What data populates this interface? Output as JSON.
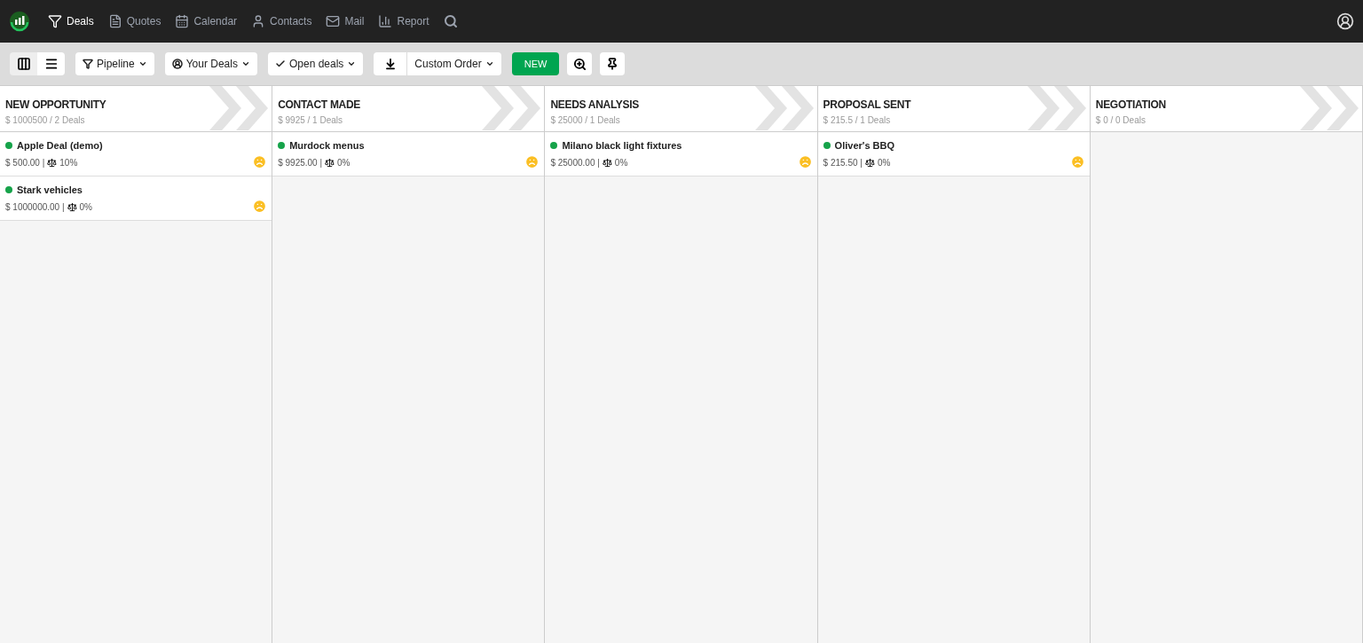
{
  "nav": {
    "items": [
      {
        "kind": "deals",
        "label": "Deals",
        "selected": true
      },
      {
        "kind": "quotes",
        "label": "Quotes",
        "selected": false
      },
      {
        "kind": "calendar",
        "label": "Calendar",
        "selected": false
      },
      {
        "kind": "contacts",
        "label": "Contacts",
        "selected": false
      },
      {
        "kind": "mail",
        "label": "Mail",
        "selected": false
      },
      {
        "kind": "report",
        "label": "Report",
        "selected": false
      }
    ]
  },
  "toolbar": {
    "views": [
      {
        "kind": "kanban",
        "selected": true
      },
      {
        "kind": "list",
        "selected": false
      }
    ],
    "filters": [
      {
        "kind": "pipeline",
        "label": "Pipeline"
      },
      {
        "kind": "owner",
        "label": "Your Deals"
      },
      {
        "kind": "status",
        "label": "Open deals"
      }
    ],
    "sort": {
      "label": "Custom Order"
    },
    "new_button": "NEW"
  },
  "stages": [
    {
      "title": "NEW OPPORTUNITY",
      "summary": "$ 1000500 / 2 Deals",
      "deals": [
        {
          "name": "Apple Deal (demo)",
          "amount": "$ 500.00 |",
          "probability": "10%",
          "color": "#16a34a"
        },
        {
          "name": "Stark vehicles",
          "amount": "$ 1000000.00 |",
          "probability": "0%",
          "color": "#16a34a"
        }
      ]
    },
    {
      "title": "CONTACT MADE",
      "summary": "$ 9925 / 1 Deals",
      "deals": [
        {
          "name": "Murdock menus",
          "amount": "$ 9925.00 |",
          "probability": "0%",
          "color": "#16a34a"
        }
      ]
    },
    {
      "title": "NEEDS ANALYSIS",
      "summary": "$ 25000 / 1 Deals",
      "deals": [
        {
          "name": "Milano black light fixtures",
          "amount": "$ 25000.00 |",
          "probability": "0%",
          "color": "#16a34a"
        }
      ]
    },
    {
      "title": "PROPOSAL SENT",
      "summary": "$ 215.5 / 1 Deals",
      "deals": [
        {
          "name": "Oliver's BBQ",
          "amount": "$ 215.50 |",
          "probability": "0%",
          "color": "#16a34a"
        }
      ]
    },
    {
      "title": "NEGOTIATION",
      "summary": "$ 0 / 0 Deals"
    }
  ]
}
